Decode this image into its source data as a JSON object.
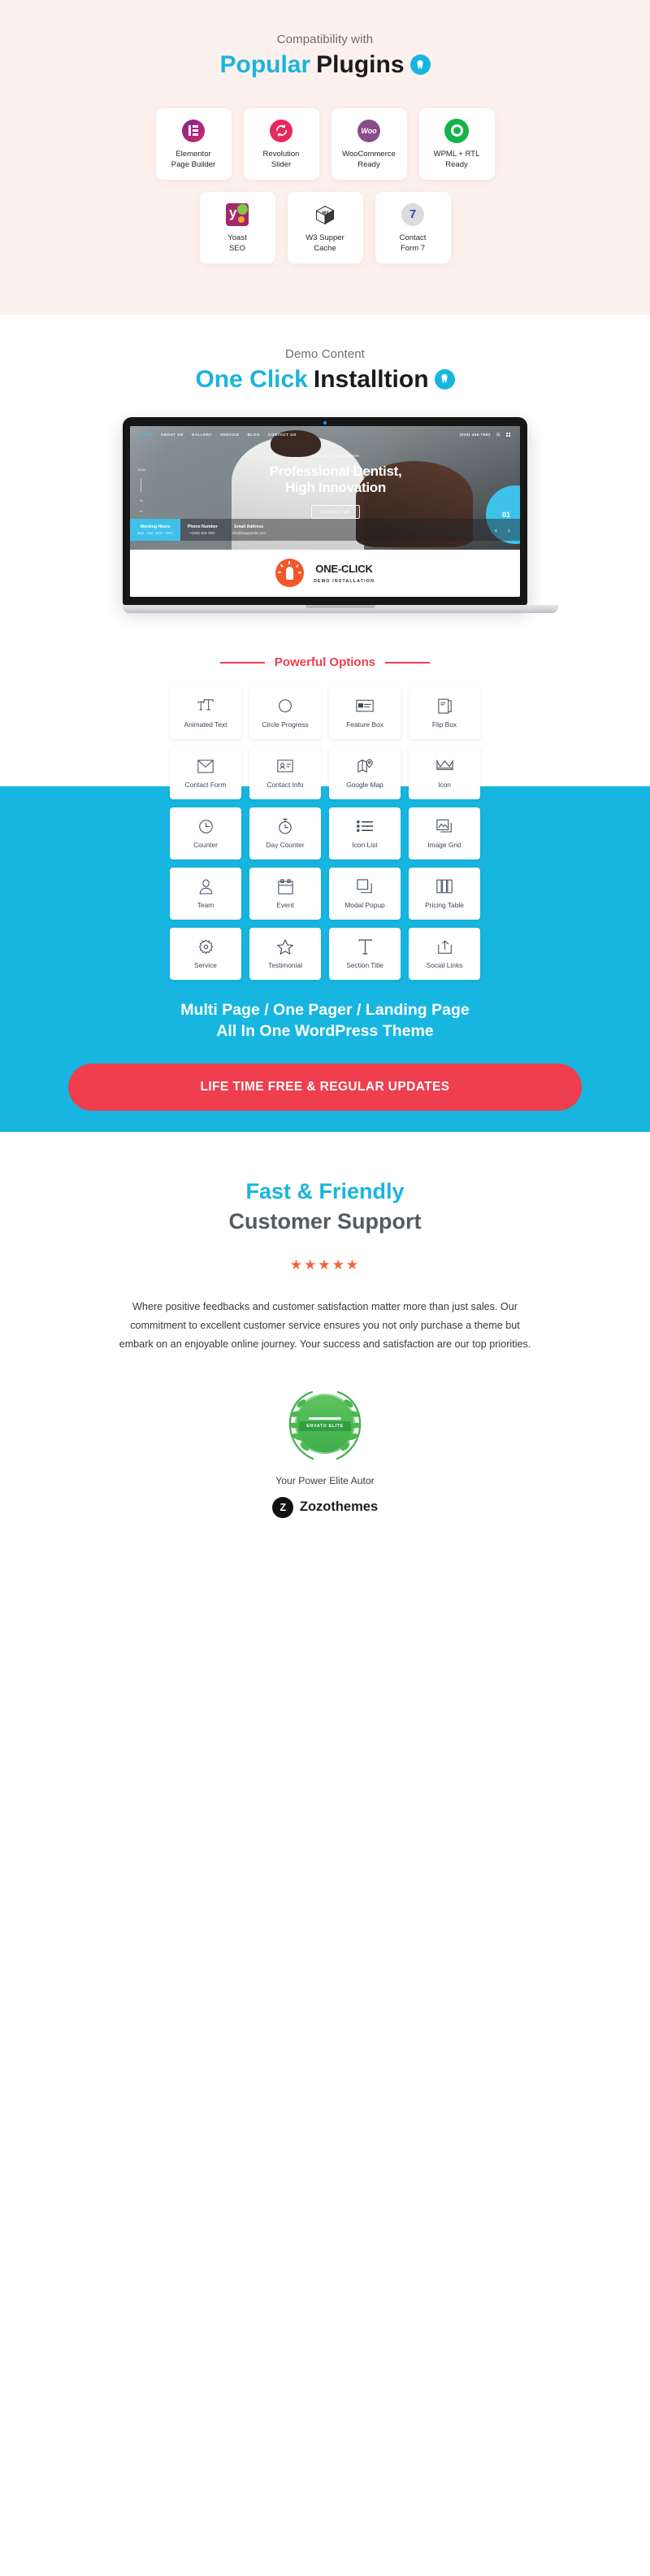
{
  "plugins_section": {
    "eyebrow": "Compatibility with",
    "title_accent": "Popular",
    "title_rest": "Plugins",
    "badge_icon": "tooth-icon",
    "row1": [
      {
        "name": "elementor",
        "icon": "elementor-icon",
        "label_line1": "Elementor",
        "label_line2": "Page Builder"
      },
      {
        "name": "revolution-slider",
        "icon": "revolution-slider-icon",
        "label_line1": "Revolution",
        "label_line2": "Slider"
      },
      {
        "name": "woocommerce",
        "icon": "woocommerce-icon",
        "label_line1": "WooCommerce",
        "label_line2": "Ready"
      },
      {
        "name": "wpml",
        "icon": "wpml-icon",
        "label_line1": "WPML + RTL",
        "label_line2": "Ready"
      }
    ],
    "row2": [
      {
        "name": "yoast-seo",
        "icon": "yoast-icon",
        "label_line1": "Yoast",
        "label_line2": "SEO"
      },
      {
        "name": "w3-super-cache",
        "icon": "w3-cube-icon",
        "label_line1": "W3 Supper",
        "label_line2": "Cache"
      },
      {
        "name": "contact-form-7",
        "icon": "contact-form-7-icon",
        "label_line1": "Contact",
        "label_line2": "Form 7"
      }
    ]
  },
  "demo_section": {
    "eyebrow": "Demo Content",
    "title_accent": "One Click",
    "title_rest": "Installtion",
    "badge_icon": "tooth-icon",
    "mockup": {
      "nav": [
        "HOME",
        "ABOUT US",
        "GALLERY",
        "SERVICE",
        "BLOG",
        "CONTACT US"
      ],
      "phone": "(528) 456-7592",
      "search_icon": "search-icon",
      "grid_icon": "grid-icon",
      "welcome": "Welcome to HappySmile",
      "hero_title_line1": "Professional Dentist,",
      "hero_title_line2": "High Innovation",
      "hero_button": "CONTACT US",
      "slide_number": "01",
      "social_rail": [
        "Social",
        "Fb",
        "In",
        "Tw"
      ],
      "info": [
        {
          "title": "Working Hours",
          "sub": "Mon - Sun : 9Am - 8Pm"
        },
        {
          "title": "Phone Number",
          "sub": "+(528) 456-7592"
        },
        {
          "title": "Email Address",
          "sub": "info@happysmile.com"
        }
      ],
      "prev_icon": "chevron-left-icon",
      "next_icon": "chevron-right-icon",
      "oneclick_title": "ONE-CLICK",
      "oneclick_sub": "DEMO INSTALLATION",
      "oneclick_icon": "lightbulb-icon"
    }
  },
  "options_section": {
    "title": "Powerful Options",
    "items": [
      {
        "label": "Animated Text",
        "icon": "animated-text-icon"
      },
      {
        "label": "Circle Progress",
        "icon": "circle-progress-icon"
      },
      {
        "label": "Feature Box",
        "icon": "feature-box-icon"
      },
      {
        "label": "Flip Box",
        "icon": "flip-box-icon"
      },
      {
        "label": "Contact Form",
        "icon": "envelope-icon"
      },
      {
        "label": "Contact Info",
        "icon": "contact-card-icon"
      },
      {
        "label": "Google Map",
        "icon": "map-pin-icon"
      },
      {
        "label": "Icon",
        "icon": "crown-icon"
      },
      {
        "label": "Counter",
        "icon": "clock-icon"
      },
      {
        "label": "Day Counter",
        "icon": "stopwatch-icon"
      },
      {
        "label": "Icon List",
        "icon": "icon-list-icon"
      },
      {
        "label": "Image Grid",
        "icon": "image-grid-icon"
      },
      {
        "label": "Team",
        "icon": "person-icon"
      },
      {
        "label": "Event",
        "icon": "calendar-icon"
      },
      {
        "label": "Modal Popup",
        "icon": "modal-popup-icon"
      },
      {
        "label": "Pricing Table",
        "icon": "pricing-table-icon"
      },
      {
        "label": "Service",
        "icon": "gear-icon"
      },
      {
        "label": "Testimonial",
        "icon": "star-outline-icon"
      },
      {
        "label": "Section Title",
        "icon": "section-title-icon"
      },
      {
        "label": "Social Links",
        "icon": "share-icon"
      }
    ]
  },
  "cyan_banner": {
    "line1": "Multi Page / One Pager / Landing Page",
    "line2": "All In One WordPress Theme",
    "cta_label": "LIFE TIME FREE & REGULAR UPDATES"
  },
  "support_section": {
    "title_accent": "Fast & Friendly",
    "title_rest": "Customer Support",
    "stars": "★★★★★",
    "paragraph": "Where positive feedbacks and customer satisfaction matter more than just sales. Our commitment to excellent customer service ensures you not only purchase a theme but embark on an enjoyable online journey. Your success and satisfaction are our top priorities.",
    "badge_ribbon": "ENVATO ELITE",
    "credit": "Your Power Elite Autor",
    "brand_mark": "Z",
    "brand_name": "Zozothemes"
  },
  "colors": {
    "accent_cyan": "#19b5dd",
    "banner_cyan": "#16b6e0",
    "accent_red": "#ef3e4e",
    "plugins_bg": "#fdf1ee",
    "star_orange": "#f4623a",
    "elite_green": "#3fae4a"
  }
}
